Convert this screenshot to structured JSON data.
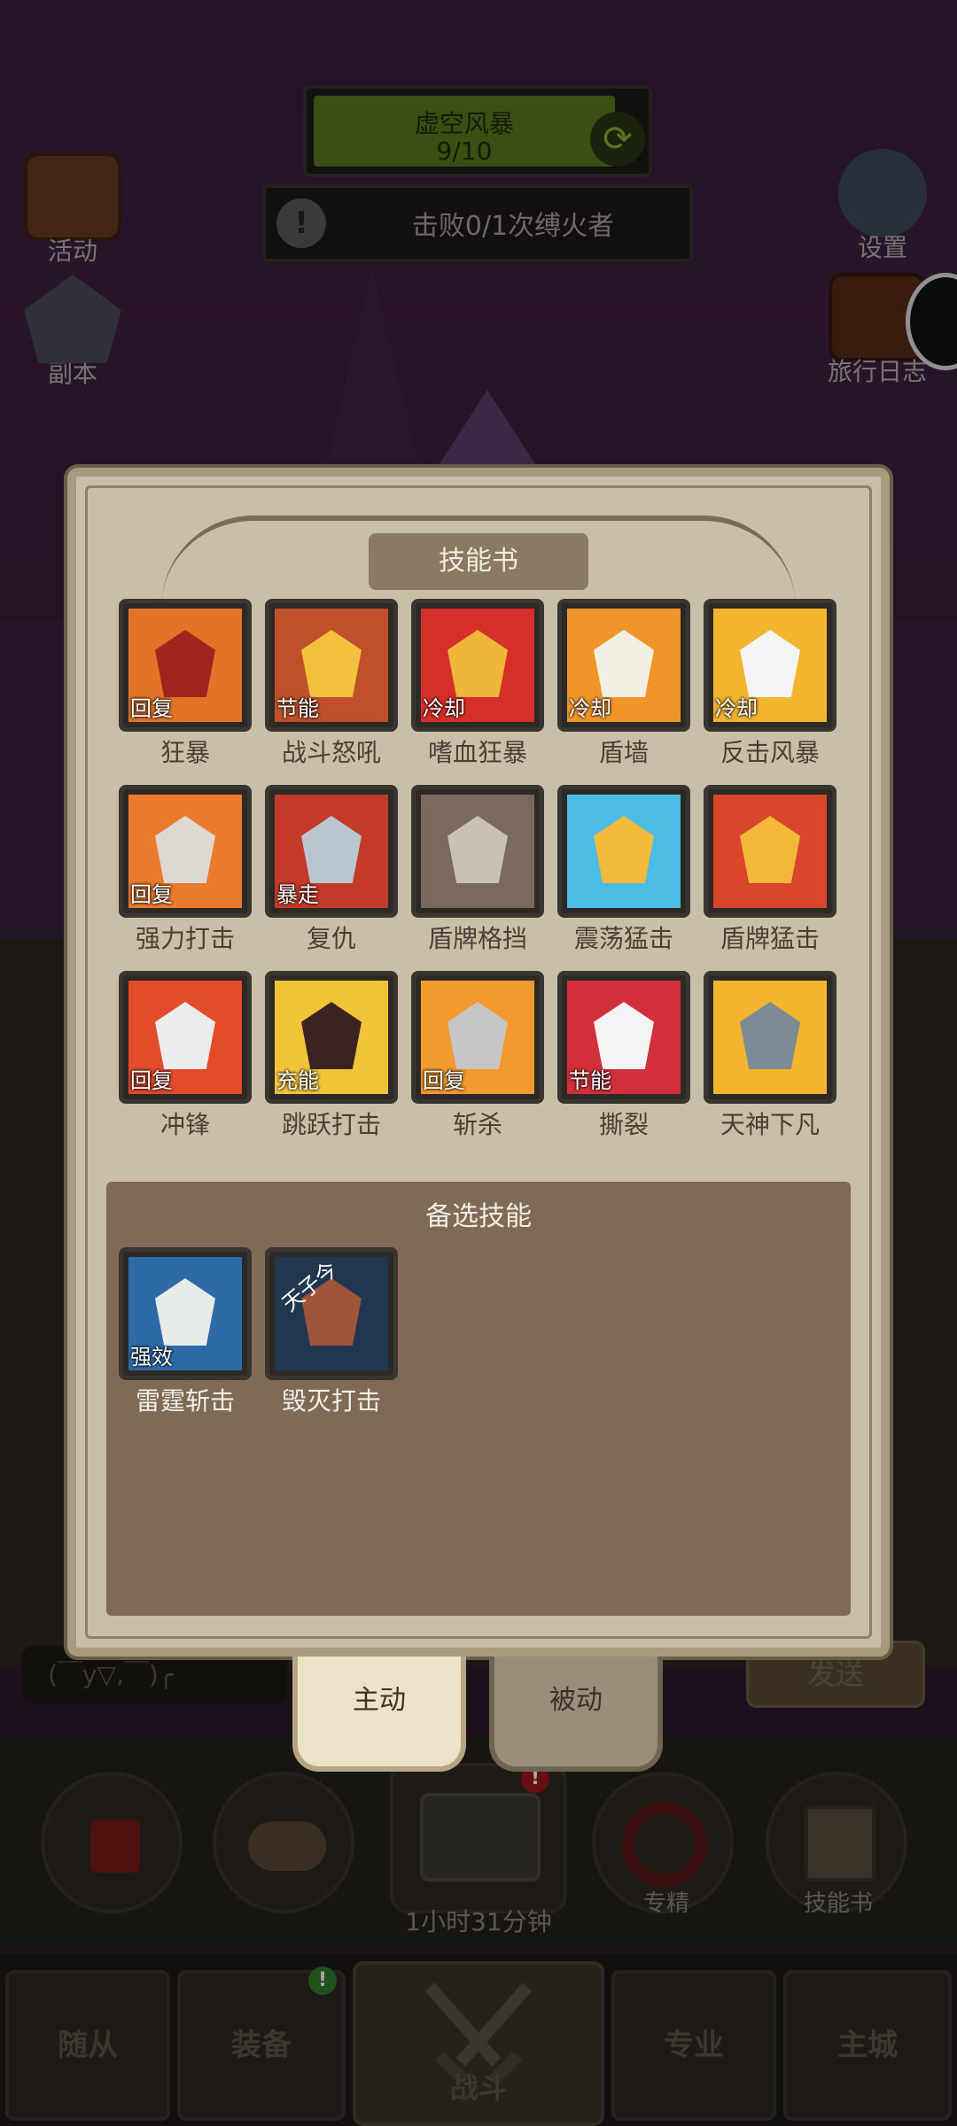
{
  "quest": {
    "title": "虚空风暴",
    "progress": "9/10",
    "objective": "击败0/1次缚火者",
    "objective_icon": "!"
  },
  "side_buttons": {
    "activity": "活动",
    "dungeon": "副本",
    "settings": "设置",
    "travel_log": "旅行日志"
  },
  "panel": {
    "title": "技能书",
    "skills": [
      {
        "name": "狂暴",
        "tag": "回复",
        "bg": "#e2742a",
        "fg": "#a3231f"
      },
      {
        "name": "战斗怒吼",
        "tag": "节能",
        "bg": "#c0502a",
        "fg": "#f3c13d"
      },
      {
        "name": "嗜血狂暴",
        "tag": "冷却",
        "bg": "#d62f2a",
        "fg": "#f0b63a"
      },
      {
        "name": "盾墙",
        "tag": "冷却",
        "bg": "#f0952a",
        "fg": "#f2efe4"
      },
      {
        "name": "反击风暴",
        "tag": "冷却",
        "bg": "#f2b52d",
        "fg": "#f4f4f4"
      },
      {
        "name": "强力打击",
        "tag": "回复",
        "bg": "#ea7a2c",
        "fg": "#ded9d0"
      },
      {
        "name": "复仇",
        "tag": "暴走",
        "bg": "#c43a2a",
        "fg": "#b9c6cf"
      },
      {
        "name": "盾牌格挡",
        "tag": "",
        "bg": "#7a6a5c",
        "fg": "#c9c1b6"
      },
      {
        "name": "震荡猛击",
        "tag": "",
        "bg": "#4bbce3",
        "fg": "#f2bb3a"
      },
      {
        "name": "盾牌猛击",
        "tag": "",
        "bg": "#d8462b",
        "fg": "#f3b83a"
      },
      {
        "name": "冲锋",
        "tag": "回复",
        "bg": "#e34b2a",
        "fg": "#ececec"
      },
      {
        "name": "跳跃打击",
        "tag": "充能",
        "bg": "#f2c437",
        "fg": "#3a2320"
      },
      {
        "name": "斩杀",
        "tag": "回复",
        "bg": "#f29a2f",
        "fg": "#c6c6c6"
      },
      {
        "name": "撕裂",
        "tag": "节能",
        "bg": "#d12f3a",
        "fg": "#f4f4f4"
      },
      {
        "name": "天神下凡",
        "tag": "",
        "bg": "#f2b52d",
        "fg": "#7c8a96"
      }
    ],
    "reserve_title": "备选技能",
    "reserve_skills": [
      {
        "name": "雷霆斩击",
        "tag": "强效",
        "bg": "#2f6aa8",
        "fg": "#e8ece8"
      },
      {
        "name": "毁灭打击",
        "tag": "",
        "bg": "#1f3850",
        "fg": "#a0553a",
        "overlay": "天子今"
      }
    ]
  },
  "tabs": {
    "active": "主动",
    "passive": "被动"
  },
  "chat": {
    "input_text": "(￣y▽,￣)╭",
    "send": "发送"
  },
  "actions": {
    "specialize": "专精",
    "skill_book": "技能书",
    "timer": "1小时31分钟",
    "badge": "!"
  },
  "nav": {
    "followers": "随从",
    "equipment": "装备",
    "battle": "战斗",
    "profession": "专业",
    "main_city": "主城",
    "equipment_badge": "!"
  }
}
